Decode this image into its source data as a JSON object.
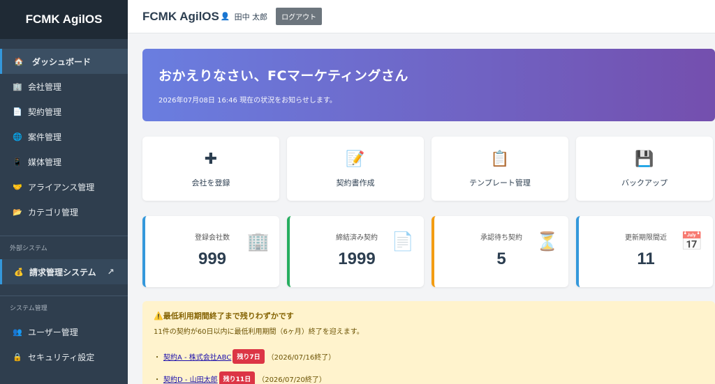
{
  "sidebar": {
    "brand": "FCMK AgilOS",
    "items": [
      {
        "icon": "🏠",
        "label": "ダッシュボード"
      },
      {
        "icon": "🏢",
        "label": "会社管理"
      },
      {
        "icon": "📄",
        "label": "契約管理"
      },
      {
        "icon": "🌐",
        "label": "案件管理"
      },
      {
        "icon": "📱",
        "label": "媒体管理"
      },
      {
        "icon": "🤝",
        "label": "アライアンス管理"
      },
      {
        "icon": "📂",
        "label": "カテゴリ管理"
      }
    ],
    "external_section": "外部システム",
    "external_item": {
      "icon": "💰",
      "label": "請求管理システム",
      "ext": "↗"
    },
    "system_section": "システム管理",
    "system_items": [
      {
        "icon": "👥",
        "label": "ユーザー管理"
      },
      {
        "icon": "🔒",
        "label": "セキュリティ設定"
      }
    ]
  },
  "header": {
    "title": "FCMK AgilOS",
    "user_icon": "👤",
    "user_name": "田中 太郎",
    "logout_label": "ログアウト"
  },
  "hero": {
    "title": "おかえりなさい、FCマーケティングさん",
    "subtitle": "2026年07月08日 16:46 現在の状況をお知らせします。"
  },
  "actions": [
    {
      "icon": "✚",
      "label": "会社を登録"
    },
    {
      "icon": "📝",
      "label": "契約書作成"
    },
    {
      "icon": "📋",
      "label": "テンプレート管理"
    },
    {
      "icon": "💾",
      "label": "バックアップ"
    }
  ],
  "stats": [
    {
      "label": "登録会社数",
      "value": "999",
      "icon": "🏢",
      "color": "#3498db"
    },
    {
      "label": "締結済み契約",
      "value": "1999",
      "icon": "📄",
      "color": "#27ae60"
    },
    {
      "label": "承認待ち契約",
      "value": "5",
      "icon": "⏳",
      "color": "#f39c12"
    },
    {
      "label": "更新期限間近",
      "value": "11",
      "icon": "📅",
      "color": "#3498db"
    }
  ],
  "alert": {
    "icon": "⚠️",
    "title": "最低利用期間終了まで残りわずかです",
    "desc": "11件の契約が60日以内に最低利用期間（6ヶ月）終了を迎えます。",
    "items": [
      {
        "link": "契約A - 株式会社ABC",
        "badge": "残り7日",
        "date": "（2026/07/16終了）"
      },
      {
        "link": "契約D - 山田太郎",
        "badge": "残り11日",
        "date": "（2026/07/20終了）"
      }
    ]
  }
}
